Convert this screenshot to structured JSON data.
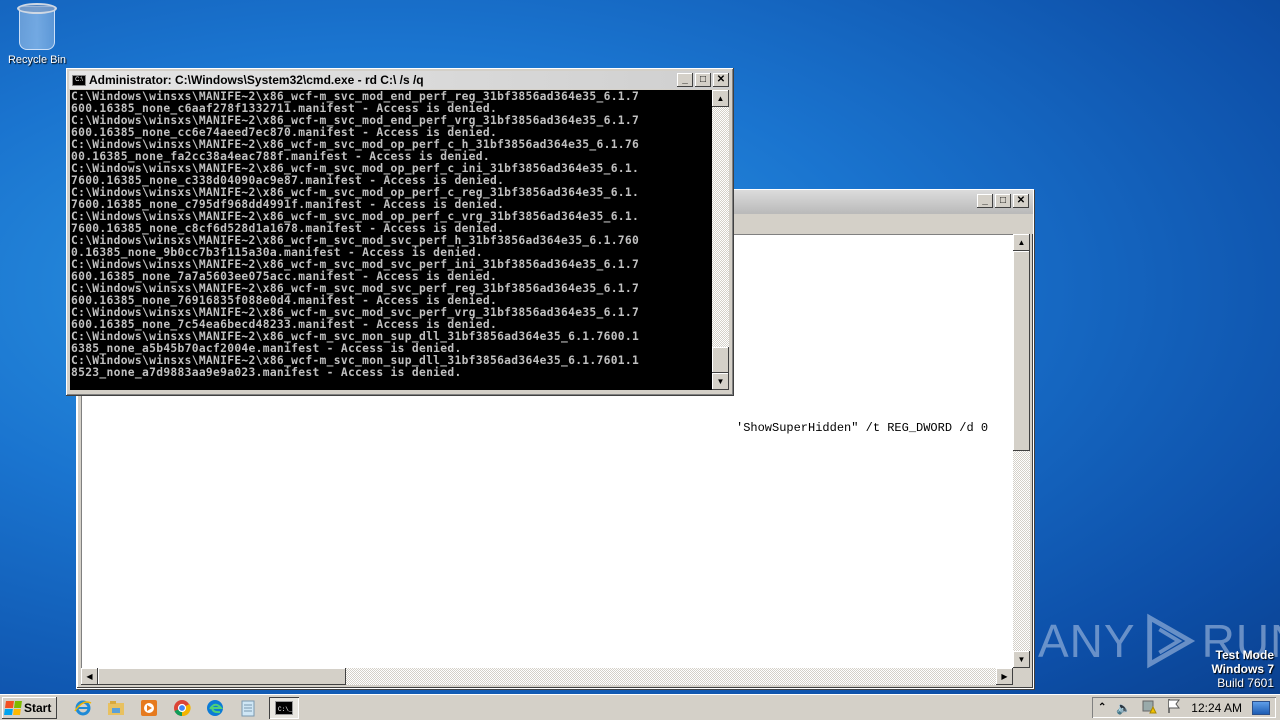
{
  "desktop": {
    "icons": [
      {
        "label": "Recycle Bin",
        "icon": "recycle-bin-icon"
      }
    ],
    "watermark": {
      "left": "ANY",
      "right": "RUN"
    },
    "test_mode": {
      "line1": "Test Mode",
      "line2": "Windows 7",
      "line3": "Build 7601"
    }
  },
  "cmd_window": {
    "title": "Administrator: C:\\Windows\\System32\\cmd.exe - rd  C:\\ /s /q",
    "icon": "console-icon",
    "buttons": {
      "minimize": "_",
      "maximize": "□",
      "close": "✕"
    },
    "lines": [
      "C:\\Windows\\winsxs\\MANIFE~2\\x86_wcf-m_svc_mod_end_perf_reg_31bf3856ad364e35_6.1.7",
      "600.16385_none_c6aaf278f1332711.manifest - Access is denied.",
      "C:\\Windows\\winsxs\\MANIFE~2\\x86_wcf-m_svc_mod_end_perf_vrg_31bf3856ad364e35_6.1.7",
      "600.16385_none_cc6e74aeed7ec870.manifest - Access is denied.",
      "C:\\Windows\\winsxs\\MANIFE~2\\x86_wcf-m_svc_mod_op_perf_c_h_31bf3856ad364e35_6.1.76",
      "00.16385_none_fa2cc38a4eac788f.manifest - Access is denied.",
      "C:\\Windows\\winsxs\\MANIFE~2\\x86_wcf-m_svc_mod_op_perf_c_ini_31bf3856ad364e35_6.1.",
      "7600.16385_none_c338d04090ac9e87.manifest - Access is denied.",
      "C:\\Windows\\winsxs\\MANIFE~2\\x86_wcf-m_svc_mod_op_perf_c_reg_31bf3856ad364e35_6.1.",
      "7600.16385_none_c795df968dd4991f.manifest - Access is denied.",
      "C:\\Windows\\winsxs\\MANIFE~2\\x86_wcf-m_svc_mod_op_perf_c_vrg_31bf3856ad364e35_6.1.",
      "7600.16385_none_c8cf6d528d1a1678.manifest - Access is denied.",
      "C:\\Windows\\winsxs\\MANIFE~2\\x86_wcf-m_svc_mod_svc_perf_h_31bf3856ad364e35_6.1.760",
      "0.16385_none_9b0cc7b3f115a30a.manifest - Access is denied.",
      "C:\\Windows\\winsxs\\MANIFE~2\\x86_wcf-m_svc_mod_svc_perf_ini_31bf3856ad364e35_6.1.7",
      "600.16385_none_7a7a5603ee075acc.manifest - Access is denied.",
      "C:\\Windows\\winsxs\\MANIFE~2\\x86_wcf-m_svc_mod_svc_perf_reg_31bf3856ad364e35_6.1.7",
      "600.16385_none_76916835f088e0d4.manifest - Access is denied.",
      "C:\\Windows\\winsxs\\MANIFE~2\\x86_wcf-m_svc_mod_svc_perf_vrg_31bf3856ad364e35_6.1.7",
      "600.16385_none_7c54ea6becd48233.manifest - Access is denied.",
      "C:\\Windows\\winsxs\\MANIFE~2\\x86_wcf-m_svc_mon_sup_dll_31bf3856ad364e35_6.1.7600.1",
      "6385_none_a5b45b70acf2004e.manifest - Access is denied.",
      "C:\\Windows\\winsxs\\MANIFE~2\\x86_wcf-m_svc_mon_sup_dll_31bf3856ad364e35_6.1.7601.1",
      "8523_none_a7d9883aa9e9a023.manifest - Access is denied."
    ]
  },
  "background_window": {
    "visible_text": "'ShowSuperHidden\" /t REG_DWORD /d 0",
    "buttons": {
      "minimize": "_",
      "maximize": "□",
      "close": "✕"
    }
  },
  "taskbar": {
    "start_label": "Start",
    "pinned": [
      {
        "name": "internet-explorer-icon"
      },
      {
        "name": "file-explorer-icon"
      },
      {
        "name": "media-player-icon"
      },
      {
        "name": "chrome-icon"
      },
      {
        "name": "edge-icon"
      },
      {
        "name": "notepad-icon"
      },
      {
        "name": "cmd-icon",
        "active": true
      }
    ],
    "tray": {
      "clock": "12:24 AM"
    }
  }
}
